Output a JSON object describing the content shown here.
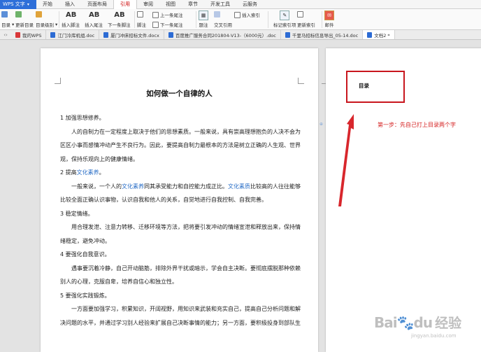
{
  "app": {
    "name": "WPS 文字"
  },
  "menu": [
    "开始",
    "插入",
    "页面布局",
    "引用",
    "审阅",
    "视图",
    "章节",
    "开发工具",
    "云服务"
  ],
  "menu_active_index": 3,
  "ribbon": {
    "toc": "目录",
    "update_toc": "更新目录",
    "toc_level": "目录级别",
    "insert_footnote": "插入脚注",
    "insert_endnote": "插入尾注",
    "next_footnote": "下一条脚注",
    "prev_endnote": "上一条尾注",
    "next_endnote": "下一条尾注",
    "footnote_endnote": "脚注",
    "caption": "题注",
    "cross_ref": "交叉引用",
    "insert_index": "插入索引",
    "mark_index": "标记索引项",
    "update_index": "更新索引",
    "mail": "邮件"
  },
  "tabs": [
    {
      "label": "我的WPS",
      "icon": "wps-icon"
    },
    {
      "label": "江门冷库机组.doc",
      "icon": "word-icon"
    },
    {
      "label": "厦门冲床招标文件.docx",
      "icon": "word-icon"
    },
    {
      "label": "百度推广服务合同201804-V13-（6000元）.doc",
      "icon": "word-icon"
    },
    {
      "label": "千里马招标信息导出_05-14.doc",
      "icon": "word-icon"
    },
    {
      "label": "文档2 *",
      "icon": "word-icon"
    }
  ],
  "document": {
    "title": "如何做一个自律的人",
    "sections": [
      {
        "heading": "1 加强思想修养。",
        "body": "人的自制力在一定程度上取决于他们的思想素质。一般来说，具有崇高理想抱负的人决不会为区区小事而感情冲动产生不良行为。因此，要提高自制力最根本的方法是树立正确的人生观、世界观，保持乐观向上的健康情绪。"
      },
      {
        "heading_prefix": "2 提高",
        "heading_link": "文化素养",
        "heading_suffix": "。"
      },
      {
        "body_prefix": "一般来说，一个人的",
        "link1": "文化素养",
        "body_mid": "同其承受能力和自控能力成正比。",
        "link2": "文化素质",
        "body_suffix": "比较高的人往往能够比较全面正确认识事物，认识自我和他人的关系，自觉地进行自我控制、自我完善。"
      },
      {
        "heading": "3 稳定情绪。",
        "body": "用合理发泄、注意力转移、迁移环境等方法，把将要引发冲动的情绪宣泄和释放出来，保持情绪稳定，避免冲动。"
      },
      {
        "heading": "4 要强化自我意识。",
        "body": "遇事要沉着冷静，自己开动脑筋，排除外界干扰或暗示，学会自主决断。要彻底摆脱那种依赖别人的心理，克服自卑，培养自信心和独立性。"
      },
      {
        "heading": "5 要强化实践锻炼。",
        "body": "一方面要加强学习，积累知识，开阔视野，用知识来武装和充实自己，提高自己分析问题和解决问题的水平，并通过学习别人经验来扩展自己决断事情的能力；另一方面，要积极投身到部队生"
      }
    ]
  },
  "right_page": {
    "toc_text": "目录",
    "annotation": "第一步：先自己打上目录两个字"
  },
  "watermark": {
    "logo": "Bai",
    "logo2": "du",
    "cn": "经验",
    "url": "jingyan.baidu.com"
  },
  "colors": {
    "accent": "#2e6fd9",
    "annotation": "#d52222",
    "link": "#2b6fc7"
  }
}
